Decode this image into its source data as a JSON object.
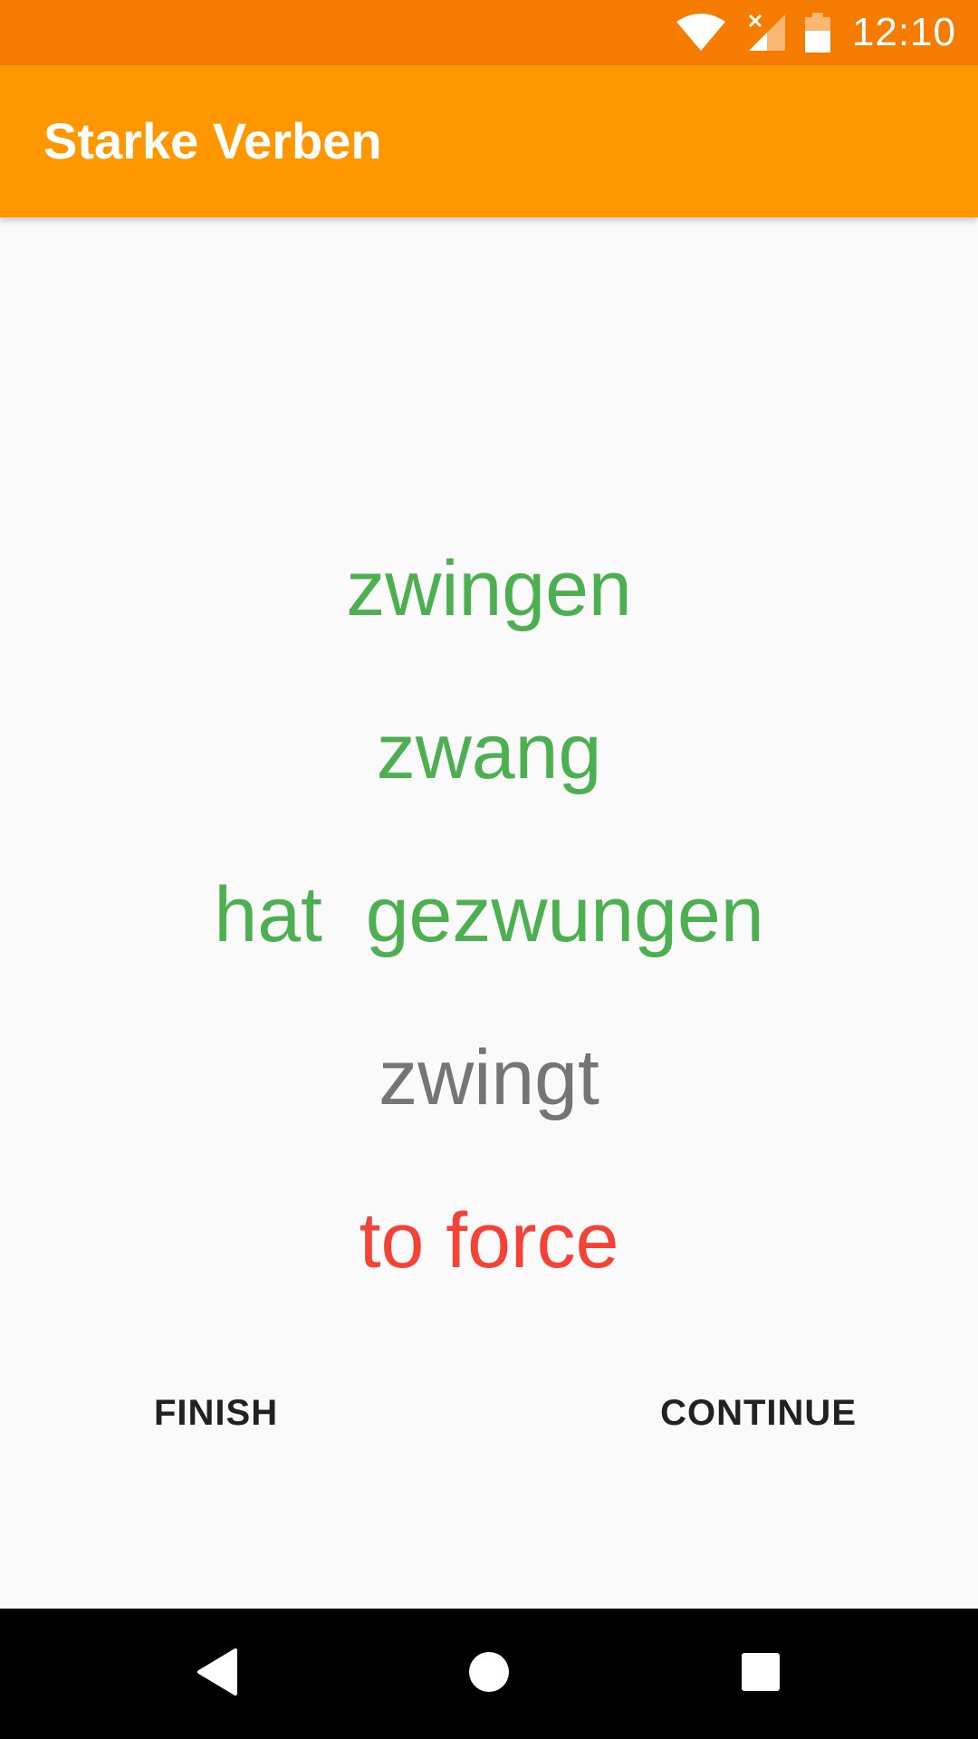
{
  "status_bar": {
    "time": "12:10",
    "icons": [
      "wifi-icon",
      "cellular-no-signal-icon",
      "battery-icon"
    ],
    "color": "#F57C00"
  },
  "app_bar": {
    "title": "Starke Verben",
    "color": "#FF9800"
  },
  "verb": {
    "infinitive": "zwingen",
    "praeteritum": "zwang",
    "perfekt": "hat  gezwungen",
    "present_3rd": "zwingt",
    "translation": "to force"
  },
  "colors": {
    "correct": "#4CAF50",
    "neutral": "#757575",
    "translation": "#F44336"
  },
  "actions": {
    "finish_label": "FINISH",
    "continue_label": "CONTINUE"
  },
  "nav_bar": {
    "icons": [
      "back-icon",
      "home-icon",
      "recents-icon"
    ]
  }
}
